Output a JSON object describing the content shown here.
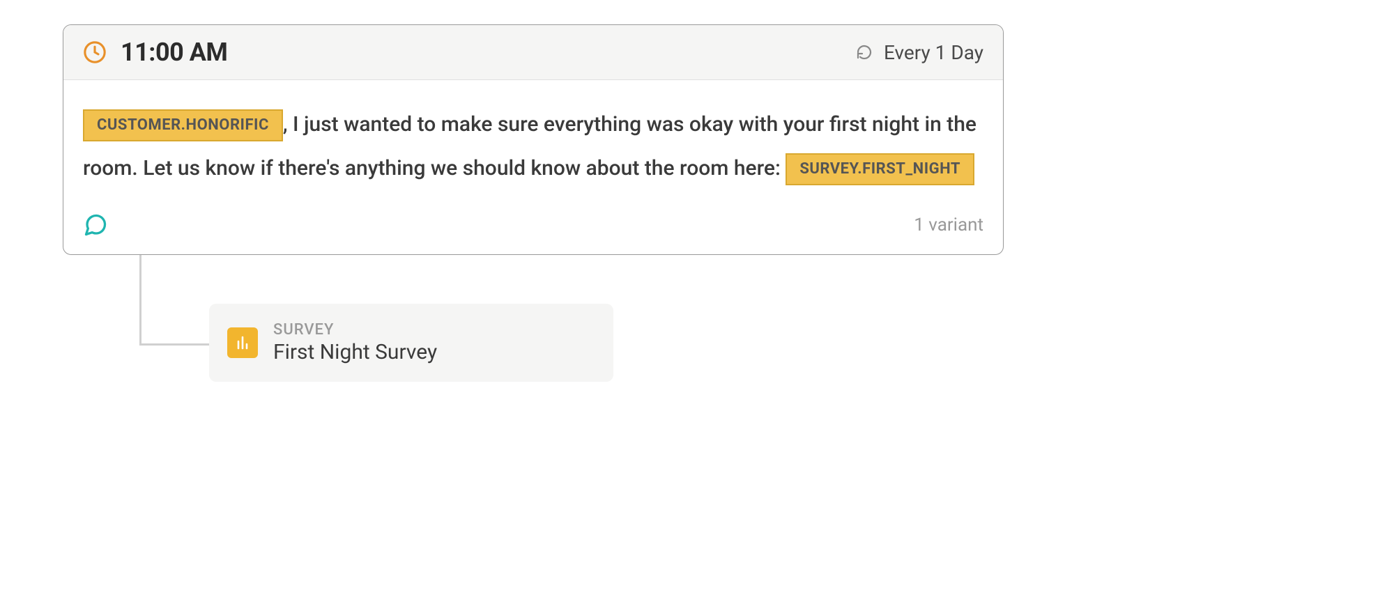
{
  "message": {
    "schedule": {
      "time": "11:00 AM",
      "recurrence": "Every 1 Day"
    },
    "tokens": {
      "customer_honorific": "CUSTOMER.HONORIFIC",
      "survey_first_night": "SURVEY.FIRST_NIGHT"
    },
    "body": {
      "part1": ", I just wanted to make sure everything was okay with your first night in the room. Let us know if there's anything we should know about the room here: "
    },
    "variant_count": "1 variant"
  },
  "survey_node": {
    "type_label": "SURVEY",
    "name": "First Night Survey"
  },
  "icons": {
    "clock": "clock-icon",
    "refresh": "refresh-icon",
    "chat_bubble": "chat-bubble-icon",
    "bar_chart": "bar-chart-icon"
  }
}
